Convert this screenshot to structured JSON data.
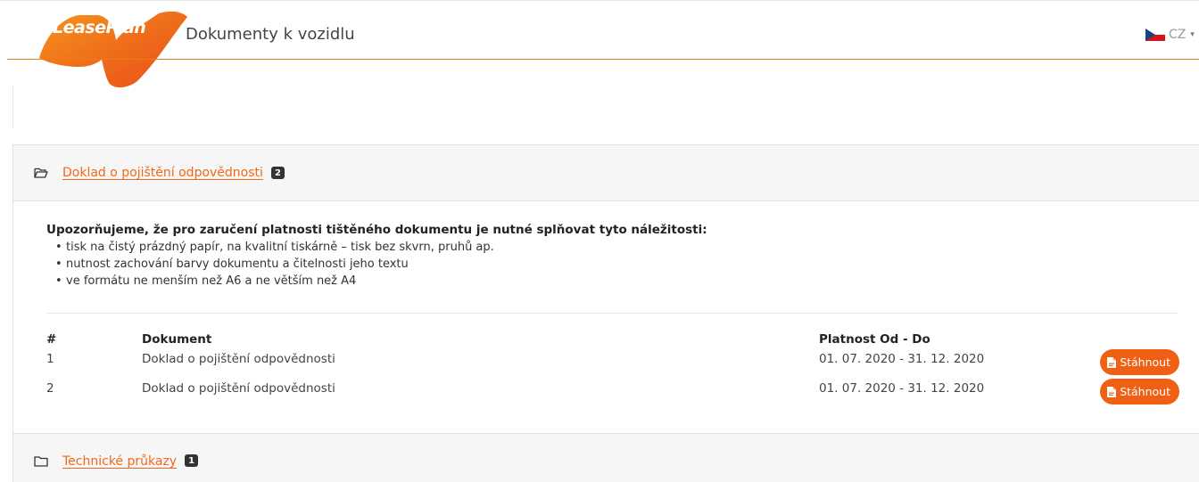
{
  "header": {
    "logo_text": "LeasePlan",
    "title": "Dokumenty k vozidlu",
    "language": "CZ",
    "flag_icon": "czech-flag-icon",
    "accent_color": "#ee7d11"
  },
  "sections": [
    {
      "title": "Doklad o pojištění odpovědnosti",
      "count": "2",
      "icon": "folder-open-icon",
      "expanded": true,
      "notice_title": "Upozorňujeme, že pro zaručení platnosti tištěného dokumentu je nutné splňovat tyto náležitosti:",
      "notice_items": [
        "tisk na čistý prázdný papír, na kvalitní tiskárně – tisk bez skvrn, pruhů ap.",
        "nutnost zachování barvy dokumentu a čitelnosti jeho textu",
        "ve formátu ne menším než A6 a ne větším než A4"
      ],
      "table": {
        "headers": [
          "#",
          "Dokument",
          "Platnost Od - Do"
        ],
        "rows": [
          {
            "num": "1",
            "document": "Doklad o pojištění odpovědnosti",
            "validity": "01. 07. 2020 - 31. 12. 2020",
            "button_label": "Stáhnout"
          },
          {
            "num": "2",
            "document": "Doklad o pojištění odpovědnosti",
            "validity": "01. 07. 2020 - 31. 12. 2020",
            "button_label": "Stáhnout"
          }
        ]
      }
    },
    {
      "title": "Technické průkazy",
      "count": "1",
      "icon": "folder-icon",
      "expanded": false
    }
  ]
}
